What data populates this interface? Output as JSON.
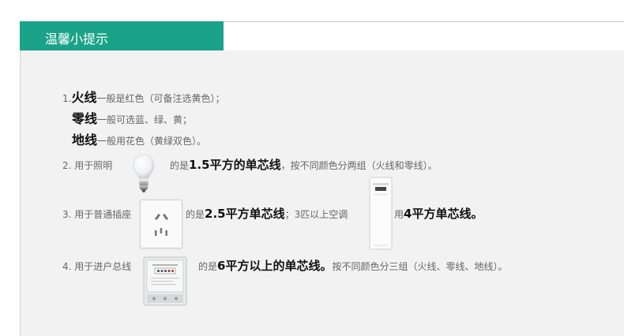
{
  "header": {
    "title": "温馨小提示"
  },
  "items": {
    "r1": {
      "num": "1.",
      "big": "火线",
      "rest": "一般是红色（可备注选黄色）；"
    },
    "r2": {
      "big": "零线",
      "rest": "一般可选蓝、绿、黄；"
    },
    "r3": {
      "big": "地线",
      "rest": "一般用花色（黄绿双色）。"
    },
    "r4": {
      "num": "2. 用于照明",
      "pre": "的是",
      "mid": "1.5平方的单芯线",
      "rest": "，按不同颜色分两组（火线和零线）。"
    },
    "r5": {
      "num": "3. 用于普通插座",
      "pre": "的是",
      "mid": "2.5平方单芯线",
      "sep": "；3匹以上空调",
      "pre2": "用",
      "mid2": "4平方单芯线。"
    },
    "r6": {
      "num": "4. 用于进户总线",
      "pre": "的是",
      "mid": "6平方以上的单芯线。",
      "rest": "按不同颜色分三组（火线、零线、地线）。"
    }
  },
  "icons": [
    "light-bulb-icon",
    "wall-socket-icon",
    "air-conditioner-icon",
    "electric-meter-icon"
  ]
}
